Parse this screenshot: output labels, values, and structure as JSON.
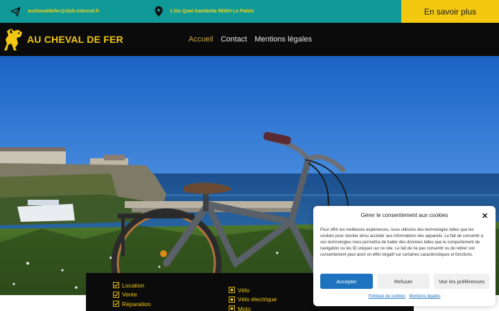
{
  "topbar": {
    "email": "auchevaldefer@club-internet.fr",
    "email_icon": "paper-plane-icon",
    "address": "1 bis Quai Gambetta 56360 Le Palais",
    "address_icon": "map-pin-icon",
    "cta_label": "En savoir plus"
  },
  "header": {
    "logo_text": "AU CHEVAL DE FER",
    "logo_icon": "horse-icon",
    "nav": [
      {
        "label": "Accueil",
        "active": true
      },
      {
        "label": "Contact"
      },
      {
        "label": "Mentions légales"
      }
    ]
  },
  "services": {
    "left": [
      "Location",
      "Vente",
      "Réparation"
    ],
    "right": [
      "Vélo",
      "Vélo électrique",
      "Moto"
    ]
  },
  "cookie": {
    "title": "Gérer le consentement aux cookies",
    "text": "Pour offrir les meilleures expériences, nous utilisons des technologies telles que les cookies pour stocker et/ou accéder aux informations des appareils. Le fait de consentir à ces technologies nous permettra de traiter des données telles que le comportement de navigation ou les ID uniques sur ce site. Le fait de ne pas consentir ou de retirer son consentement peut avoir un effet négatif sur certaines caractéristiques et fonctions.",
    "accept_label": "Accepter",
    "refuse_label": "Refuser",
    "prefs_label": "Voir les préférences",
    "policy_link": "Politique de cookies",
    "legal_link": "Mentions légales"
  },
  "colors": {
    "teal": "#0f9a98",
    "yellow": "#f2c811",
    "dark": "#0b0b0b",
    "blue_button": "#1e73be"
  }
}
